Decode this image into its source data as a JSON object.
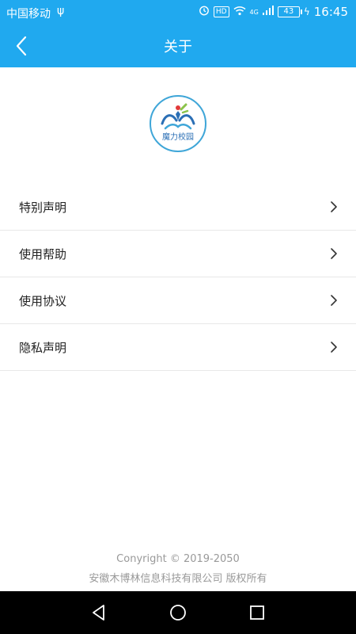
{
  "status_bar": {
    "carrier": "中国移动",
    "hd_label": "HD",
    "network_label": "4G",
    "battery_level": "43",
    "time": "16:45"
  },
  "header": {
    "title": "关于"
  },
  "logo": {
    "text": "魔力校园"
  },
  "menu": {
    "items": [
      {
        "label": "特别声明"
      },
      {
        "label": "使用帮助"
      },
      {
        "label": "使用协议"
      },
      {
        "label": "隐私声明"
      }
    ]
  },
  "footer": {
    "copyright": "Conyright © 2019-2050",
    "company": "安徽木博林信息科技有限公司 版权所有"
  },
  "colors": {
    "header_bg": "#20a9ef",
    "footer_text": "#999999",
    "logo_ring": "#3fa6d8"
  }
}
